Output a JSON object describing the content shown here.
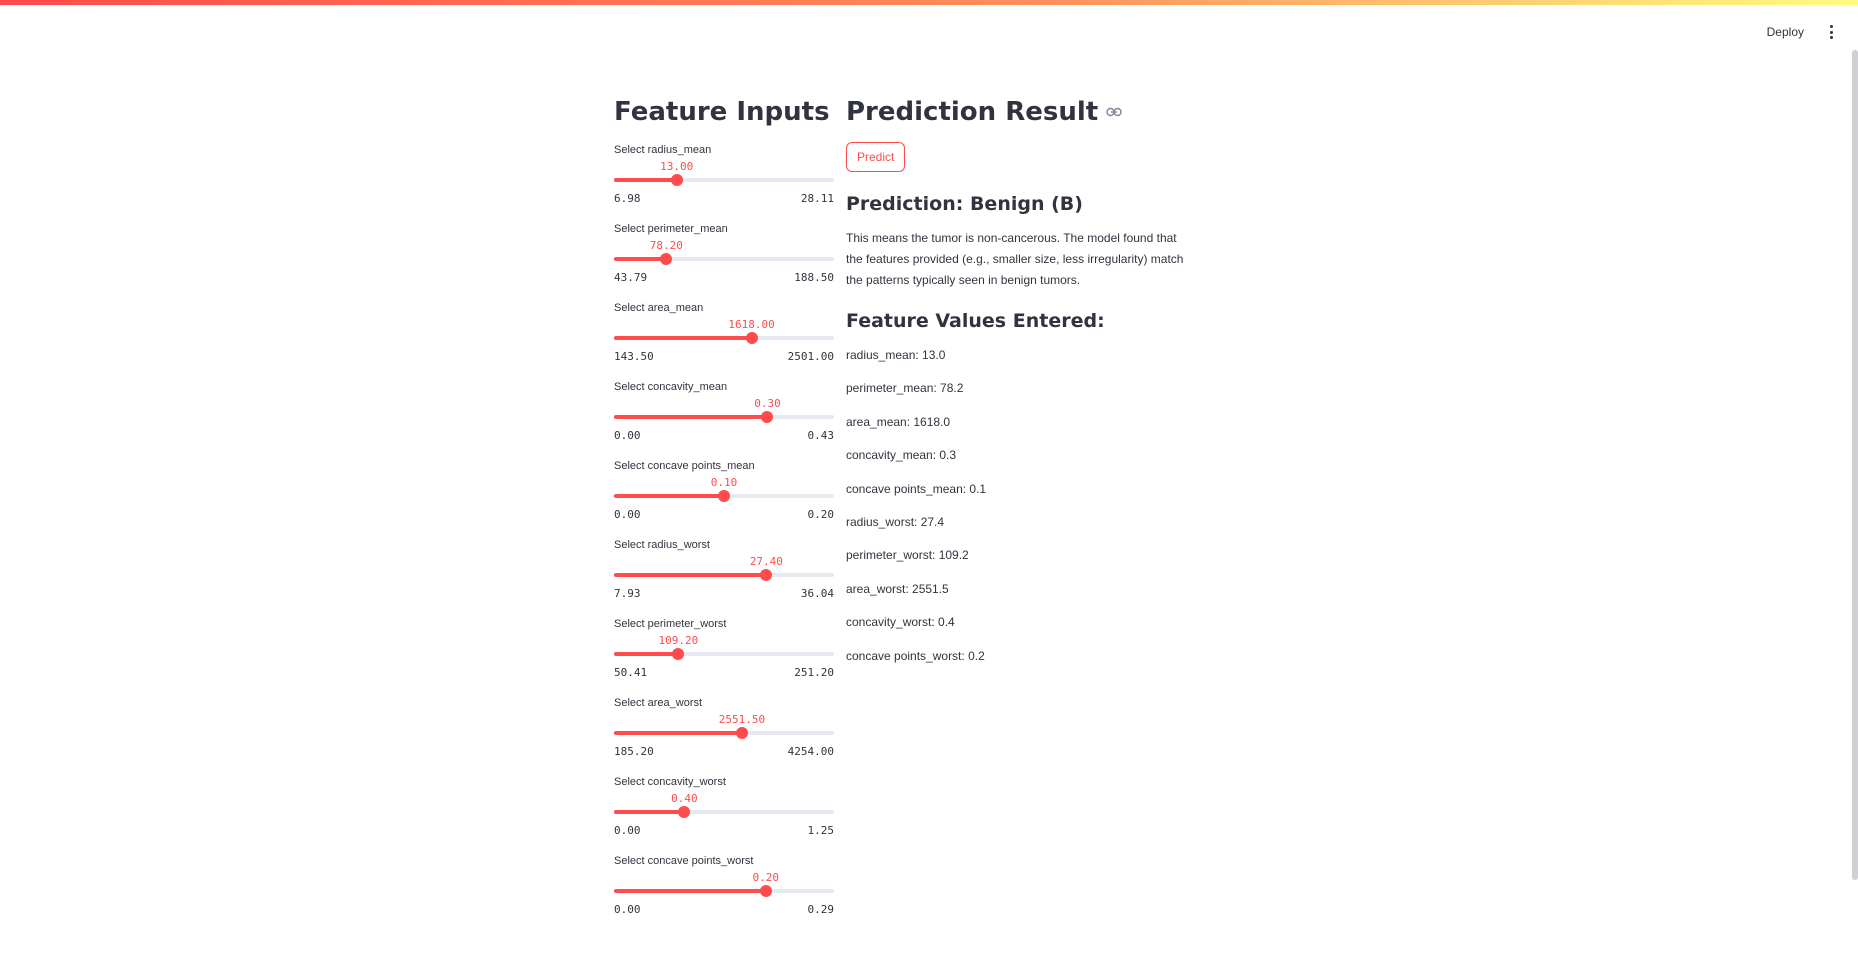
{
  "header": {
    "deploy_label": "Deploy",
    "menu_icon": "more-vertical-icon"
  },
  "left": {
    "title": "Feature Inputs",
    "sliders": [
      {
        "label": "Select radius_mean",
        "value_text": "13.00",
        "min_text": "6.98",
        "max_text": "28.11",
        "min": 6.98,
        "max": 28.11,
        "value": 13.0
      },
      {
        "label": "Select perimeter_mean",
        "value_text": "78.20",
        "min_text": "43.79",
        "max_text": "188.50",
        "min": 43.79,
        "max": 188.5,
        "value": 78.2
      },
      {
        "label": "Select area_mean",
        "value_text": "1618.00",
        "min_text": "143.50",
        "max_text": "2501.00",
        "min": 143.5,
        "max": 2501.0,
        "value": 1618.0
      },
      {
        "label": "Select concavity_mean",
        "value_text": "0.30",
        "min_text": "0.00",
        "max_text": "0.43",
        "min": 0.0,
        "max": 0.43,
        "value": 0.3
      },
      {
        "label": "Select concave points_mean",
        "value_text": "0.10",
        "min_text": "0.00",
        "max_text": "0.20",
        "min": 0.0,
        "max": 0.2,
        "value": 0.1
      },
      {
        "label": "Select radius_worst",
        "value_text": "27.40",
        "min_text": "7.93",
        "max_text": "36.04",
        "min": 7.93,
        "max": 36.04,
        "value": 27.4
      },
      {
        "label": "Select perimeter_worst",
        "value_text": "109.20",
        "min_text": "50.41",
        "max_text": "251.20",
        "min": 50.41,
        "max": 251.2,
        "value": 109.2
      },
      {
        "label": "Select area_worst",
        "value_text": "2551.50",
        "min_text": "185.20",
        "max_text": "4254.00",
        "min": 185.2,
        "max": 4254.0,
        "value": 2551.5
      },
      {
        "label": "Select concavity_worst",
        "value_text": "0.40",
        "min_text": "0.00",
        "max_text": "1.25",
        "min": 0.0,
        "max": 1.25,
        "value": 0.4
      },
      {
        "label": "Select concave points_worst",
        "value_text": "0.20",
        "min_text": "0.00",
        "max_text": "0.29",
        "min": 0.0,
        "max": 0.29,
        "value": 0.2
      }
    ]
  },
  "right": {
    "title": "Prediction Result",
    "predict_label": "Predict",
    "prediction_title": "Prediction: Benign (B)",
    "description": "This means the tumor is non-cancerous. The model found that the features provided (e.g., smaller size, less irregularity) match the patterns typically seen in benign tumors.",
    "values_title": "Feature Values Entered:",
    "values": [
      "radius_mean: 13.0",
      "perimeter_mean: 78.2",
      "area_mean: 1618.0",
      "concavity_mean: 0.3",
      "concave points_mean: 0.1",
      "radius_worst: 27.4",
      "perimeter_worst: 109.2",
      "area_worst: 2551.5",
      "concavity_worst: 0.4",
      "concave points_worst: 0.2"
    ]
  },
  "colors": {
    "accent": "#ff4b4b",
    "track": "#e6e9ef",
    "text": "#31333f"
  }
}
